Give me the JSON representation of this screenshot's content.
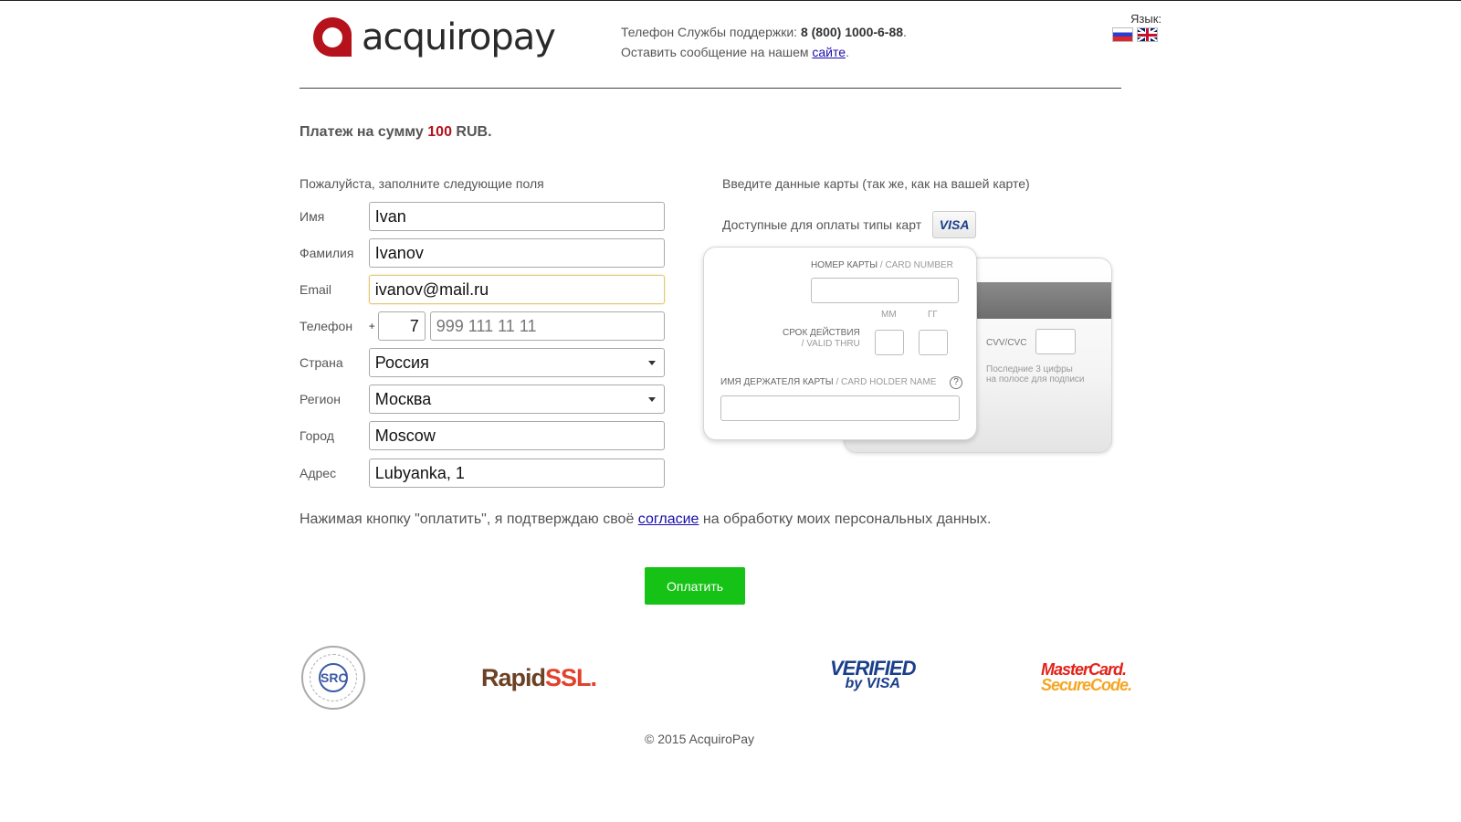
{
  "header": {
    "logo_text": "acquiropay",
    "support_prefix": "Телефон Службы поддержки: ",
    "support_phone": "8 (800) 1000-6-88",
    "support_suffix": ".",
    "message_prefix": "Оставить сообщение на нашем ",
    "message_link": "сайте",
    "message_suffix": ".",
    "language_label": "Язык:",
    "flags": [
      "flag-ru-icon",
      "flag-uk-icon"
    ]
  },
  "payment": {
    "prefix": "Платеж на сумму ",
    "amount": "100",
    "currency": " RUB."
  },
  "form": {
    "title": "Пожалуйста, заполните следующие поля",
    "first_name": {
      "label": "Имя",
      "value": "Ivan"
    },
    "last_name": {
      "label": "Фамилия",
      "value": "Ivanov"
    },
    "email": {
      "label": "Email",
      "value": "ivanov@mail.ru"
    },
    "phone": {
      "label": "Телефон",
      "plus": "+",
      "code": "7",
      "placeholder": "999 111 11 11"
    },
    "country": {
      "label": "Страна",
      "value": "Россия"
    },
    "region": {
      "label": "Регион",
      "value": "Москва"
    },
    "city": {
      "label": "Город",
      "value": "Moscow"
    },
    "address": {
      "label": "Адрес",
      "value": "Lubyanka, 1"
    }
  },
  "card": {
    "title": "Введите данные карты (так же, как на вашей карте)",
    "types_label": "Доступные для оплаты типы карт",
    "types": [
      "VISA"
    ],
    "number_label": "НОМЕР КАРТЫ",
    "number_label_en": " / CARD NUMBER",
    "expiry_label": "СРОК ДЕЙСТВИЯ",
    "expiry_label_en": "/ VALID THRU",
    "month_label": "ММ",
    "year_label": "ГГ",
    "holder_label": "ИМЯ ДЕРЖАТЕЛЯ КАРТЫ",
    "holder_label_en": " / CARD HOLDER NAME",
    "help": "?",
    "cvv_label": "CVV/CVC",
    "cvv_hint_1": "Последние 3 цифры",
    "cvv_hint_2": "на полосе для подписи"
  },
  "consent": {
    "prefix": "Нажимая кнопку \"оплатить\", я подтверждаю своё ",
    "link": "согласие",
    "suffix": " на обработку моих персональных данных."
  },
  "pay_button": "Оплатить",
  "badges": {
    "src": "SRC",
    "rapidssl_1": "Rapid",
    "rapidssl_2": "SSL.",
    "verified_1": "VERIFIED",
    "verified_2": "by VISA",
    "mastercard_1": "MasterCard.",
    "mastercard_2": "SecureCode."
  },
  "footer": {
    "copyright": "© 2015 AcquiroPay"
  },
  "colors": {
    "brand_red": "#b5121b",
    "pay_green": "#16c216",
    "link_blue": "#1a0dab"
  }
}
